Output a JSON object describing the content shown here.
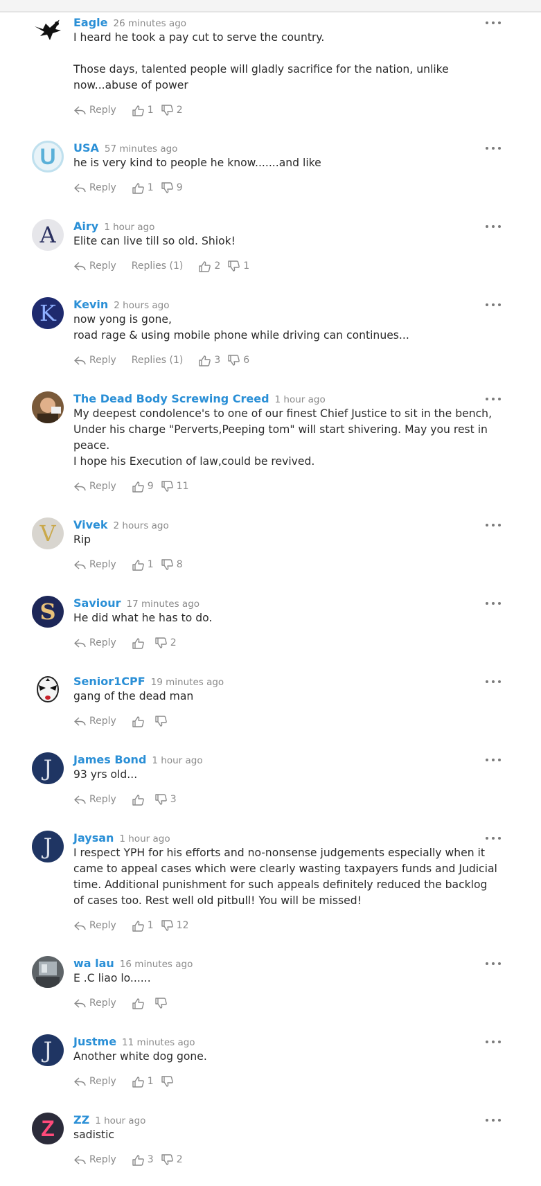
{
  "labels": {
    "reply": "Reply"
  },
  "comments": [
    {
      "author": "Eagle",
      "time": "26 minutes ago",
      "paragraphs": [
        "I heard he took a pay cut to serve the country.",
        "Those days, talented people will gladly sacrifice for the nation, unlike now...abuse of power"
      ],
      "paragraph_gap": true,
      "replies": "",
      "likes": "1",
      "dislikes": "2",
      "avatar": "eagle-avatar",
      "avatar_letter": ""
    },
    {
      "author": "USA",
      "time": "57 minutes ago",
      "paragraphs": [
        "he is very kind to people he know.......and like"
      ],
      "replies": "",
      "likes": "1",
      "dislikes": "9",
      "avatar": "letter-u-avatar",
      "avatar_letter": "U"
    },
    {
      "author": "Airy",
      "time": "1 hour ago",
      "paragraphs": [
        "Elite can live till so old. Shiok!"
      ],
      "replies": "Replies (1)",
      "likes": "2",
      "dislikes": "1",
      "avatar": "letter-a-avatar",
      "avatar_letter": "A"
    },
    {
      "author": "Kevin",
      "time": "2 hours ago",
      "paragraphs": [
        "now yong is gone,",
        "road rage & using mobile phone while driving can continues..."
      ],
      "replies": "Replies (1)",
      "likes": "3",
      "dislikes": "6",
      "avatar": "letter-k-avatar",
      "avatar_letter": "K"
    },
    {
      "author": "The Dead Body Screwing Creed",
      "time": "1 hour ago",
      "paragraphs": [
        "My deepest condolence's to one of our finest Chief Justice to sit in the bench, Under his charge \"Perverts,Peeping tom\" will start shivering. May you rest in peace.",
        "I hope his Execution of law,could be revived."
      ],
      "replies": "",
      "likes": "9",
      "dislikes": "11",
      "avatar": "photo-avatar",
      "avatar_letter": ""
    },
    {
      "author": "Vivek",
      "time": "2 hours ago",
      "paragraphs": [
        "Rip"
      ],
      "replies": "",
      "likes": "1",
      "dislikes": "8",
      "avatar": "letter-v-avatar",
      "avatar_letter": "V"
    },
    {
      "author": "Saviour",
      "time": "17 minutes ago",
      "paragraphs": [
        "He did what he has to do."
      ],
      "replies": "",
      "likes": "",
      "dislikes": "2",
      "avatar": "letter-s-avatar",
      "avatar_letter": "S"
    },
    {
      "author": "Senior1CPF",
      "time": "19 minutes ago",
      "paragraphs": [
        "gang of the dead man"
      ],
      "replies": "",
      "likes": "",
      "dislikes": "",
      "avatar": "mask-avatar",
      "avatar_letter": ""
    },
    {
      "author": "James Bond",
      "time": "1 hour ago",
      "paragraphs": [
        "93 yrs old..."
      ],
      "replies": "",
      "likes": "",
      "dislikes": "3",
      "avatar": "letter-j-avatar",
      "avatar_letter": "J"
    },
    {
      "author": "Jaysan",
      "time": "1 hour ago",
      "paragraphs": [
        "I respect YPH for his efforts and no-nonsense judgements especially when it came to appeal cases which were clearly wasting taxpayers funds and Judicial time. Additional punishment for such appeals definitely reduced the backlog of cases too. Rest well old pitbull! You will be missed!"
      ],
      "replies": "",
      "likes": "1",
      "dislikes": "12",
      "avatar": "letter-j-avatar",
      "avatar_letter": "J"
    },
    {
      "author": "wa lau",
      "time": "16 minutes ago",
      "paragraphs": [
        "E .C liao lo......"
      ],
      "replies": "",
      "likes": "",
      "dislikes": "",
      "avatar": "room-photo-avatar",
      "avatar_letter": ""
    },
    {
      "author": "Justme",
      "time": "11 minutes ago",
      "paragraphs": [
        "Another white dog gone."
      ],
      "replies": "",
      "likes": "1",
      "dislikes": "",
      "avatar": "letter-j-avatar",
      "avatar_letter": "J"
    },
    {
      "author": "ZZ",
      "time": "1 hour ago",
      "paragraphs": [
        "sadistic"
      ],
      "replies": "",
      "likes": "3",
      "dislikes": "2",
      "avatar": "letter-z-avatar",
      "avatar_letter": "Z"
    }
  ]
}
